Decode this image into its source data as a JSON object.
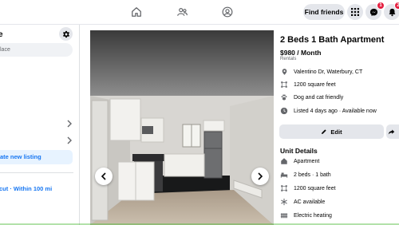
{
  "topbar": {
    "find_friends_label": "Find friends",
    "messenger_badge": "1",
    "notifications_badge": "24"
  },
  "sidebar": {
    "title": "e",
    "search_placeholder": "lace",
    "create_listing_label": "ate new listing",
    "location_text": "cut · Within 100 mi"
  },
  "listing": {
    "title": "2 Beds 1 Bath Apartment",
    "price": "$980 / Month",
    "category": "Rentals",
    "address": "Valentino Dr, Waterbury, CT",
    "size": "1200 square feet",
    "pets": "Dog and cat friendly",
    "listed": "Listed 4 days ago · Available now",
    "edit_label": "Edit",
    "unit_details_title": "Unit Details",
    "unit_details": [
      {
        "icon": "home-icon",
        "text": "Apartment"
      },
      {
        "icon": "bed-icon",
        "text": "2 beds · 1 bath"
      },
      {
        "icon": "size-icon",
        "text": "1200 square feet"
      },
      {
        "icon": "snowflake-icon",
        "text": "AC available"
      },
      {
        "icon": "radiator-icon",
        "text": "Electric heating"
      }
    ]
  },
  "colors": {
    "accent": "#1877f2",
    "badge": "#e41e3f",
    "button_gray": "#e4e6eb"
  }
}
